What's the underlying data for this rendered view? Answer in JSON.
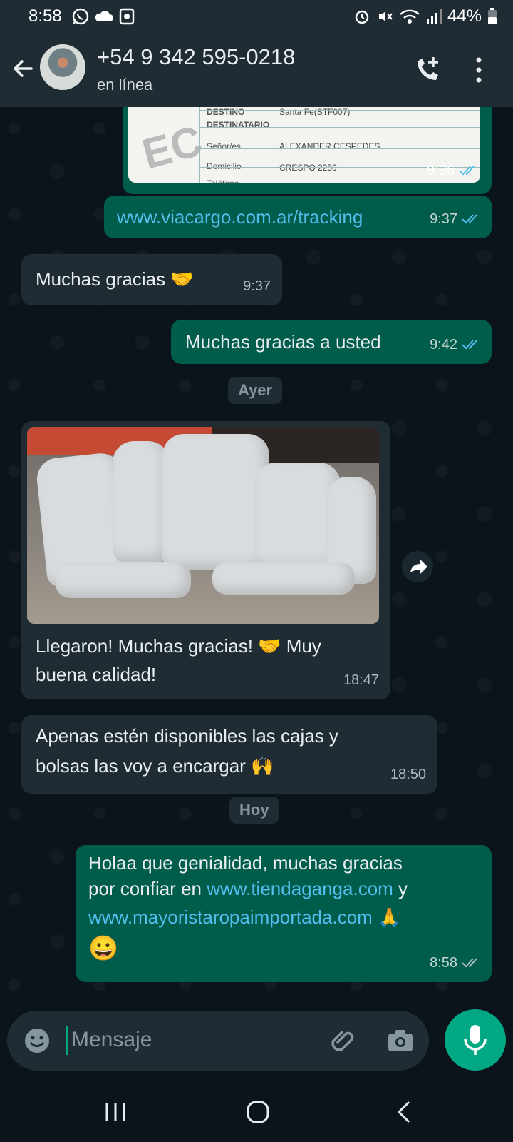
{
  "status_bar": {
    "time": "8:58",
    "battery": "44%",
    "left_icons": [
      "whatsapp-icon",
      "cloud-icon",
      "notification-app-icon"
    ],
    "right_icons": [
      "alarm-icon",
      "mute-icon",
      "wifi-icon",
      "signal-icon",
      "battery-icon"
    ]
  },
  "header": {
    "contact_name": "+54 9 342 595-0218",
    "status": "en línea"
  },
  "chat": {
    "doc_image": {
      "lines": [
        "DESTINO",
        "Santa Fe(STF007)",
        "DESTINATARIO",
        "Señor/es",
        "ALEXANDER CESPEDES",
        "Domicilio",
        "CRESPO 2250",
        "Teléfono"
      ],
      "time": "9:36"
    },
    "messages": [
      {
        "dir": "out",
        "text": "www.viacargo.com.ar/tracking",
        "time": "9:37"
      },
      {
        "dir": "in",
        "text": "Muchas gracias 🤝",
        "time": "9:37"
      },
      {
        "dir": "out",
        "text": "Muchas gracias a usted",
        "time": "9:42"
      }
    ],
    "day_ayer": "Ayer",
    "photo_msg": {
      "line1": "Llegaron! Muchas gracias! 🤝 Muy",
      "line2": "buena calidad!",
      "time": "18:47"
    },
    "msg_cajas": {
      "line1": "Apenas estén disponibles las cajas y",
      "line2": "bolsas las voy a encargar 🙌",
      "time": "18:50"
    },
    "day_hoy": "Hoy",
    "last_msg": {
      "line1": "Holaa que genialidad, muchas gracias",
      "line2_prefix": "por confiar en ",
      "link1": "www.tiendaganga.com",
      "line2_suffix": " y",
      "link2": "www.mayoristaropaimportada.com",
      "line3_suffix": " 🙏",
      "line4": "😀",
      "time": "8:58"
    }
  },
  "composer": {
    "placeholder": "Mensaje"
  },
  "colors": {
    "accent": "#00a884",
    "outgoing_bubble": "#005c4b",
    "incoming_bubble": "#1f2c34",
    "link": "#53bdeb",
    "read_ticks": "#53bdeb"
  }
}
